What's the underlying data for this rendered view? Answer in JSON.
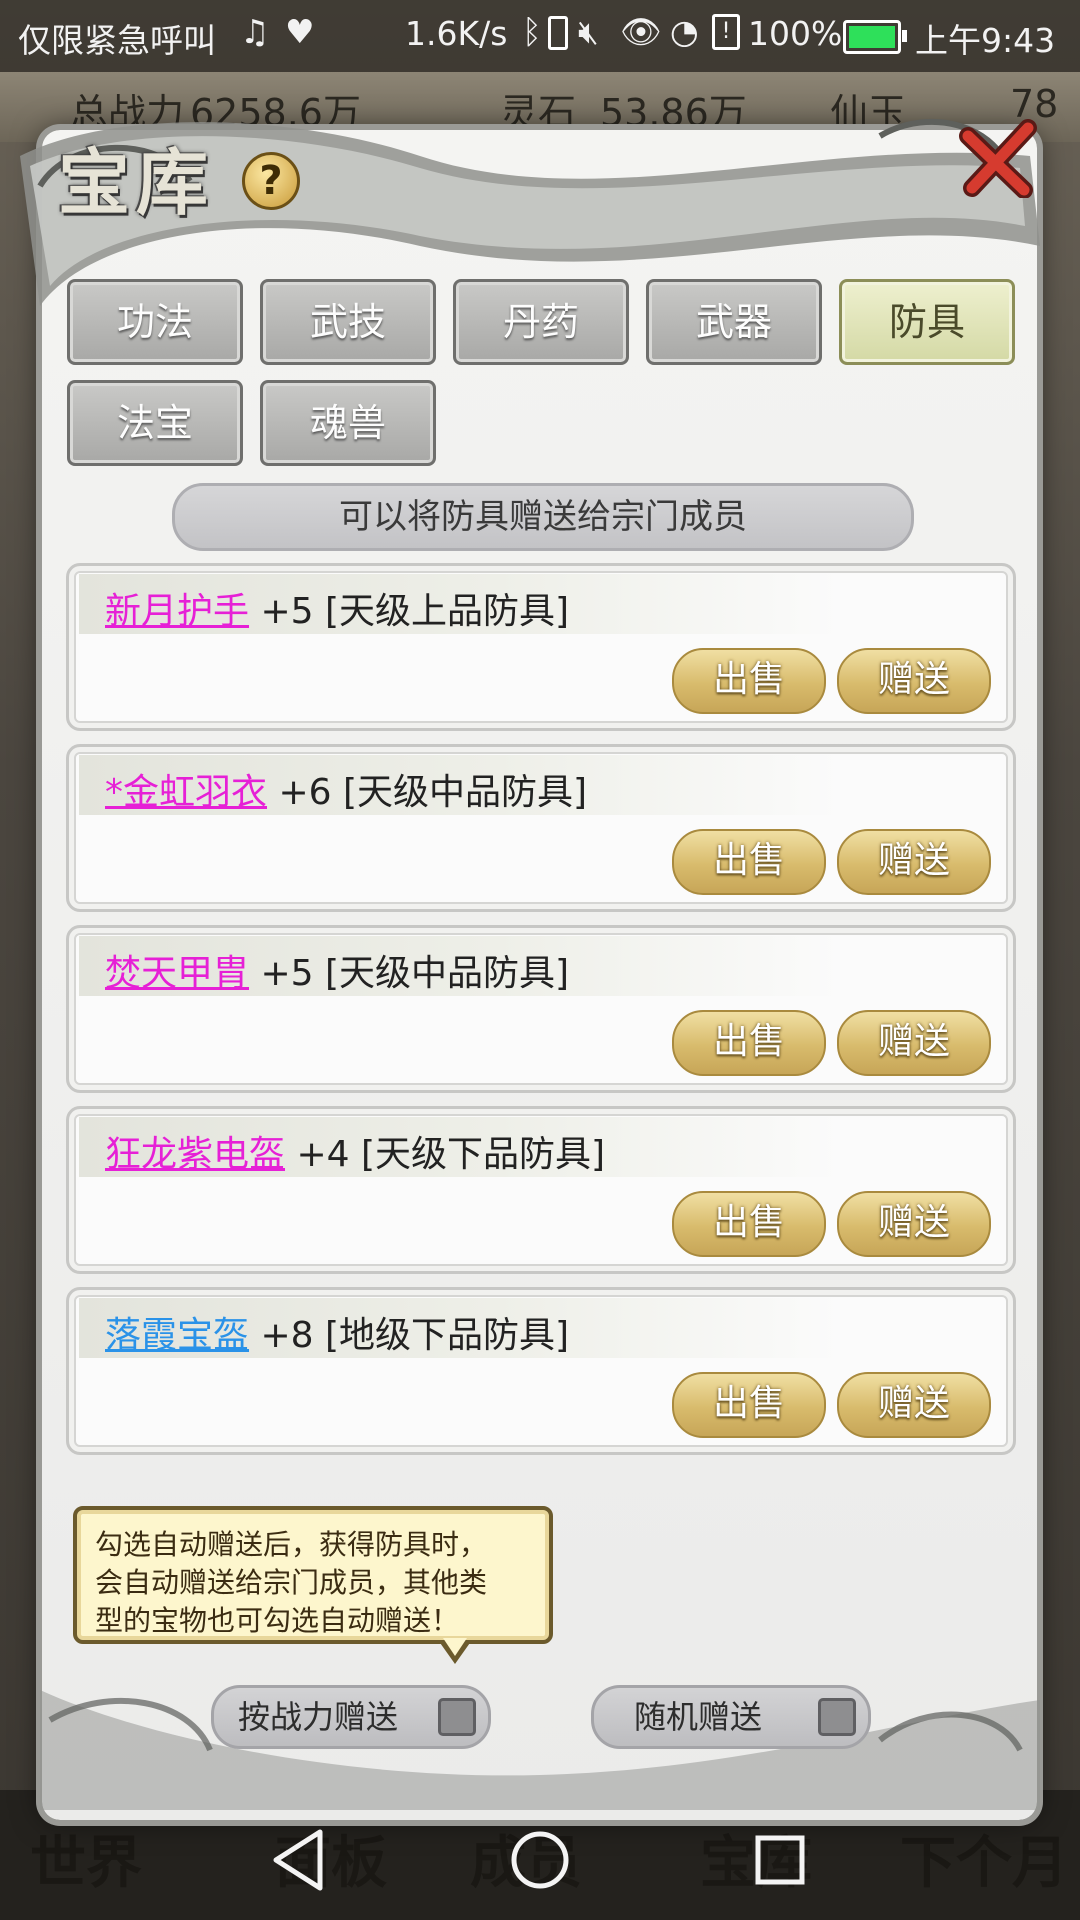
{
  "status_bar": {
    "carrier": "仅限紧急呼叫",
    "speed": "1.6K/s",
    "battery": "100%",
    "time": "上午9:43",
    "icons": [
      "music-icon",
      "heart-monitor-icon",
      "bluetooth-icon",
      "vibrate-icon",
      "mute-icon",
      "eye-icon",
      "wifi-icon",
      "sim-icon",
      "battery-icon"
    ]
  },
  "background": {
    "power_label": "总战力",
    "power_value": "6258.6万",
    "stone_label": "灵石",
    "stone_value": "53.86万",
    "jade_label": "仙玉",
    "jade_value": "78",
    "bottom_items": [
      "世界",
      "面板",
      "成员",
      "宝库",
      "下个月"
    ]
  },
  "dialog": {
    "title": "宝库",
    "help": "?",
    "tabs": [
      {
        "label": "功法",
        "active": false
      },
      {
        "label": "武技",
        "active": false
      },
      {
        "label": "丹药",
        "active": false
      },
      {
        "label": "武器",
        "active": false
      },
      {
        "label": "防具",
        "active": true
      },
      {
        "label": "法宝",
        "active": false
      },
      {
        "label": "魂兽",
        "active": false
      }
    ],
    "notice": "可以将防具赠送给宗门成员",
    "items": [
      {
        "name": "新月护手",
        "level": "+5",
        "grade": "[天级上品防具]",
        "color": "pink"
      },
      {
        "name": "*金虹羽衣",
        "level": "+6",
        "grade": "[天级中品防具]",
        "color": "pink"
      },
      {
        "name": "焚天甲胄",
        "level": "+5",
        "grade": "[天级中品防具]",
        "color": "pink"
      },
      {
        "name": "狂龙紫电盔",
        "level": "+4",
        "grade": "[天级下品防具]",
        "color": "pink"
      },
      {
        "name": "落霞宝盔",
        "level": "+8",
        "grade": "[地级下品防具]",
        "color": "blue"
      }
    ],
    "sell_label": "出售",
    "gift_label": "赠送",
    "tooltip": {
      "line1": "勾选自动赠送后，获得防具时，",
      "line2": "会自动赠送给宗门成员，其他类",
      "line3": "型的宝物也可勾选自动赠送！"
    },
    "auto_gift_power": {
      "label": "按战力赠送",
      "checked": false
    },
    "auto_gift_random": {
      "label": "随机赠送",
      "checked": false
    }
  },
  "nav": [
    "back-icon",
    "home-icon",
    "recents-icon"
  ],
  "colors": {
    "pink": "#e620d6",
    "blue": "#2a92e8",
    "gold": "#d8bb6c"
  }
}
